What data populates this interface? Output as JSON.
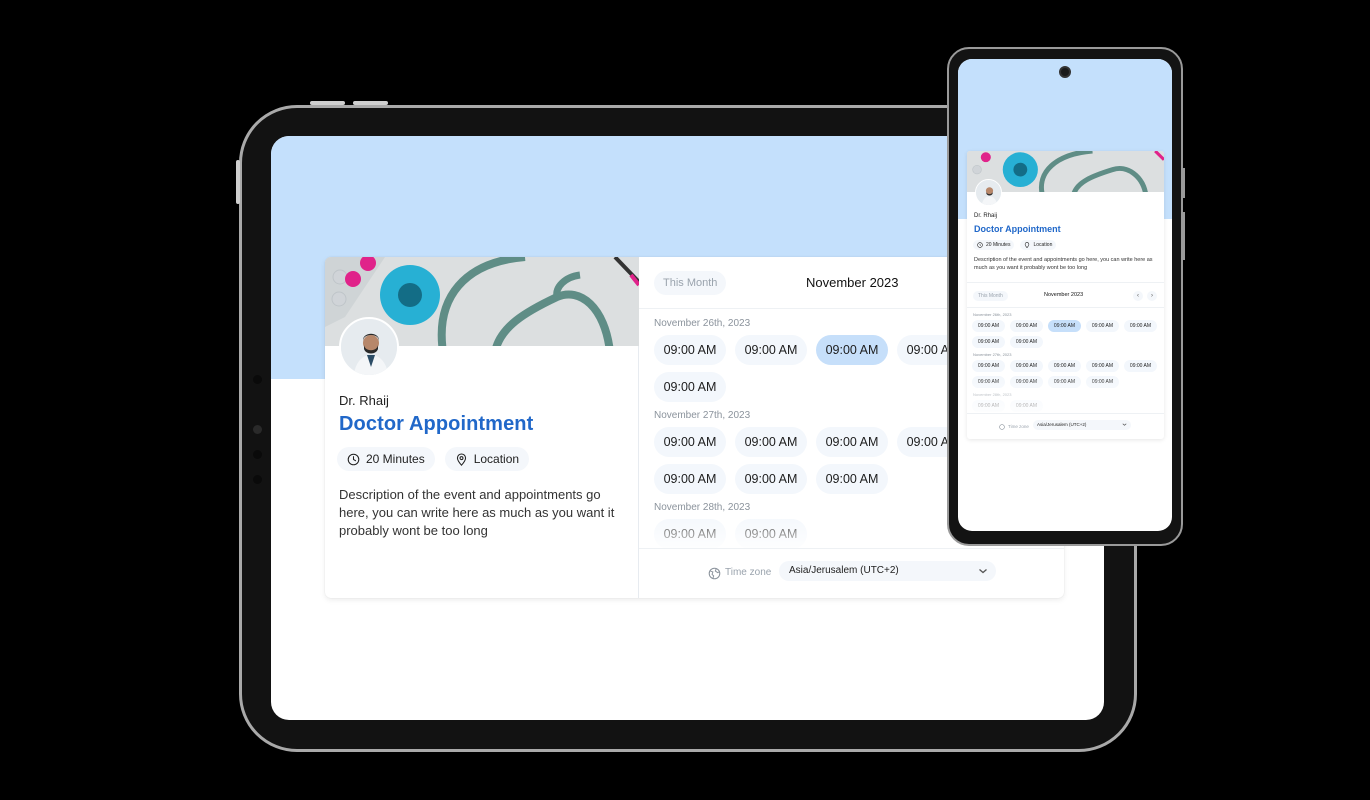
{
  "colors": {
    "accent": "#2168c9",
    "header_bg": "#c4e0fc",
    "slot_bg": "#f3f7fc",
    "slot_selected_bg": "#c6dffa"
  },
  "booking": {
    "doctor_name": "Dr. Rhaij",
    "event_title": "Doctor Appointment",
    "duration": "20 Minutes",
    "location": "Location",
    "description": "Description of the event and appointments go here, you can write here as much as you want it probably wont be too long",
    "banner_image": "stethoscope-and-pills-photo",
    "avatar_image": "doctor-portrait-photo"
  },
  "calendar": {
    "this_month_label": "This Month",
    "month_label": "November 2023",
    "prev_icon": "chevron-left-icon",
    "next_icon": "chevron-right-icon",
    "days": [
      {
        "date": "November 26th, 2023",
        "slots": [
          {
            "time": "09:00 AM",
            "selected": false
          },
          {
            "time": "09:00 AM",
            "selected": false
          },
          {
            "time": "09:00 AM",
            "selected": true
          },
          {
            "time": "09:00 AM",
            "selected": false
          },
          {
            "time": "09:00 AM",
            "selected": false
          },
          {
            "time": "09:00 AM",
            "selected": false
          },
          {
            "time": "09:00 AM",
            "selected": false
          }
        ]
      },
      {
        "date": "November 27th, 2023",
        "slots": [
          {
            "time": "09:00 AM",
            "selected": false
          },
          {
            "time": "09:00 AM",
            "selected": false
          },
          {
            "time": "09:00 AM",
            "selected": false
          },
          {
            "time": "09:00 AM",
            "selected": false
          },
          {
            "time": "09:00 AM",
            "selected": false
          },
          {
            "time": "09:00 AM",
            "selected": false
          },
          {
            "time": "09:00 AM",
            "selected": false
          },
          {
            "time": "09:00 AM",
            "selected": false
          },
          {
            "time": "09:00 AM",
            "selected": false
          }
        ]
      },
      {
        "date": "November 28th, 2023",
        "slots": [
          {
            "time": "09:00 AM",
            "selected": false
          },
          {
            "time": "09:00 AM",
            "selected": false
          }
        ]
      }
    ],
    "timezone_label": "Time zone",
    "timezone_value": "Asia/Jerusalem (UTC+2)"
  }
}
